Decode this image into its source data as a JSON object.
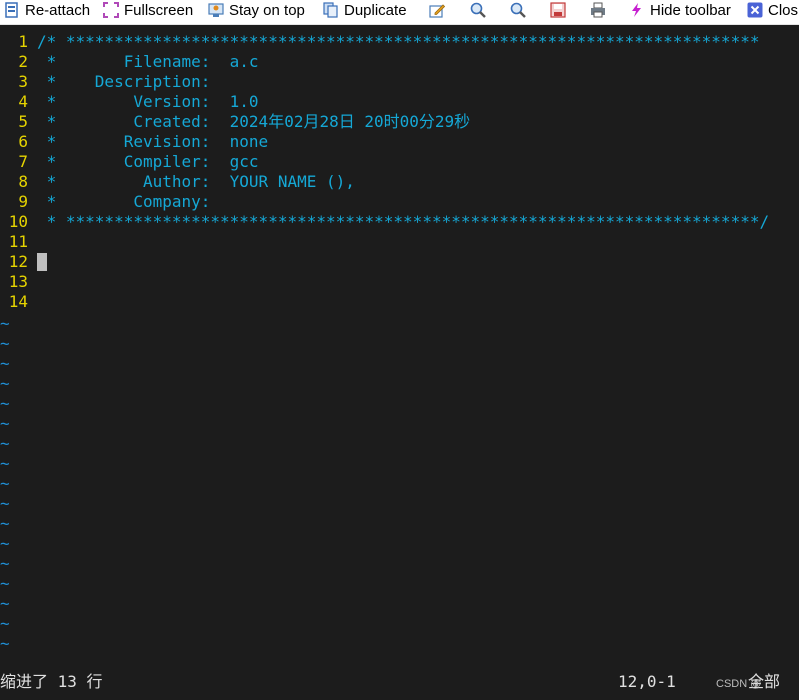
{
  "toolbar": {
    "items": [
      {
        "label": "Re-attach",
        "icon": "reattach-icon"
      },
      {
        "label": "Fullscreen",
        "icon": "fullscreen-icon"
      },
      {
        "label": "Stay on top",
        "icon": "pin-icon"
      },
      {
        "label": "Duplicate",
        "icon": "duplicate-icon"
      },
      {
        "label": "",
        "icon": "edit-icon"
      },
      {
        "label": "",
        "icon": "zoom-in-icon"
      },
      {
        "label": "",
        "icon": "zoom-out-icon"
      },
      {
        "label": "",
        "icon": "save-icon"
      },
      {
        "label": "",
        "icon": "print-icon"
      },
      {
        "label": "Hide toolbar",
        "icon": "lightning-icon"
      },
      {
        "label": "Clos",
        "icon": "close-icon"
      }
    ]
  },
  "editor": {
    "lines": [
      {
        "num": "1",
        "text": "/* ************************************************************************"
      },
      {
        "num": "2",
        "text": " *       Filename:  a.c"
      },
      {
        "num": "3",
        "text": " *    Description:"
      },
      {
        "num": "4",
        "text": " *        Version:  1.0"
      },
      {
        "num": "5",
        "text": " *        Created:  2024年02月28日 20时00分29秒"
      },
      {
        "num": "6",
        "text": " *       Revision:  none"
      },
      {
        "num": "7",
        "text": " *       Compiler:  gcc"
      },
      {
        "num": "8",
        "text": " *         Author:  YOUR NAME (),"
      },
      {
        "num": "9",
        "text": " *        Company:"
      },
      {
        "num": "10",
        "text": " * ************************************************************************/"
      },
      {
        "num": "11",
        "text": ""
      },
      {
        "num": "12",
        "text": ""
      },
      {
        "num": "13",
        "text": ""
      },
      {
        "num": "14",
        "text": ""
      }
    ],
    "empty_marker": "~",
    "empty_marker_count": 17
  },
  "status": {
    "message": "缩进了 13 行",
    "position": "12,0-1",
    "scroll": "全部"
  },
  "watermark": "CSDN @",
  "colors": {
    "background": "#1c1c1c",
    "line_number": "#e6d400",
    "comment": "#15a8d6",
    "tilde": "#1f8fd6"
  }
}
